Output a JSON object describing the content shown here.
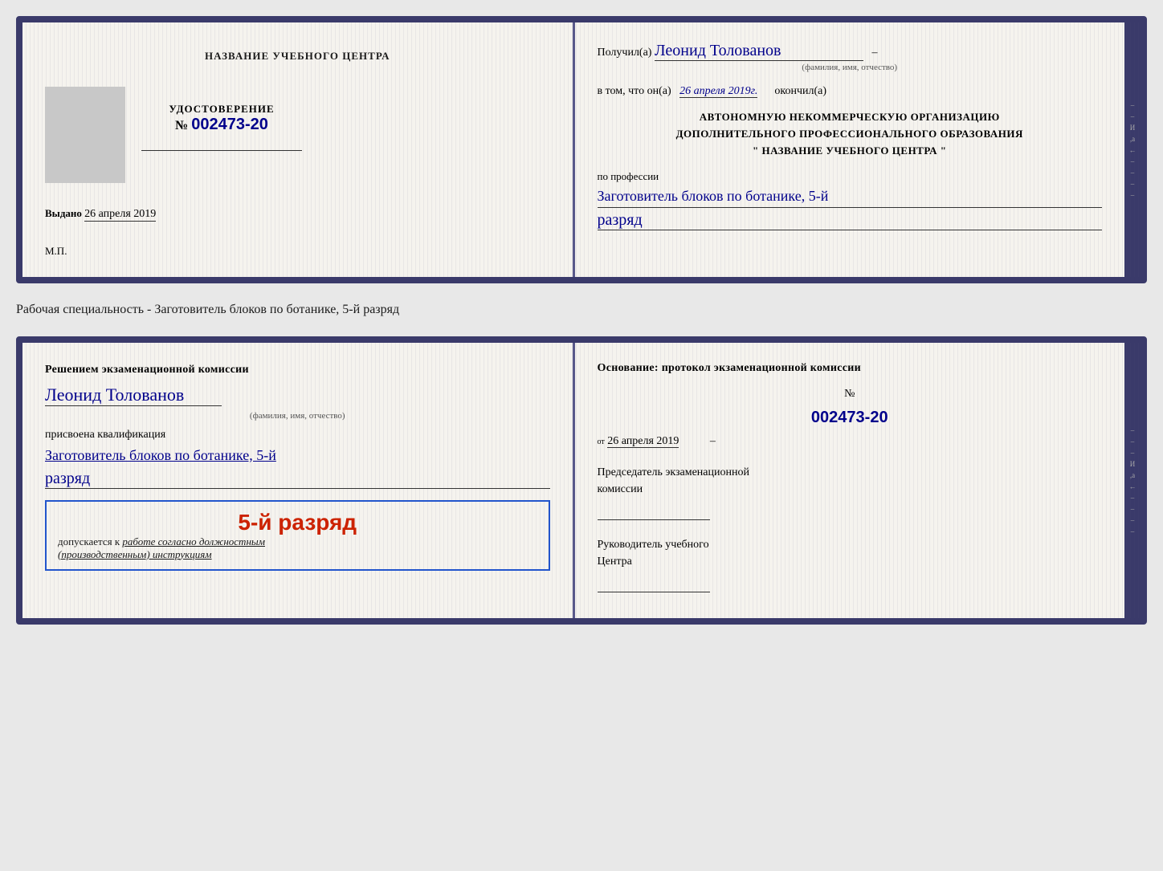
{
  "top_doc": {
    "left": {
      "title": "НАЗВАНИЕ УЧЕБНОГО ЦЕНТРА",
      "cert_label": "УДОСТОВЕРЕНИЕ",
      "cert_no_prefix": "№",
      "cert_no": "002473-20",
      "issued_label": "Выдано",
      "issued_date": "26 апреля 2019",
      "mp_label": "М.П."
    },
    "right": {
      "received_prefix": "Получил(а)",
      "received_name": "Леонид Толованов",
      "fio_label": "(фамилия, имя, отчество)",
      "vtom_text": "в том, что он(а)",
      "vtom_date": "26 апреля 2019г.",
      "okoncil": "окончил(а)",
      "org_line1": "АВТОНОМНУЮ НЕКОММЕРЧЕСКУЮ ОРГАНИЗАЦИЮ",
      "org_line2": "ДОПОЛНИТЕЛЬНОГО ПРОФЕССИОНАЛЬНОГО ОБРАЗОВАНИЯ",
      "org_line3": "\"   НАЗВАНИЕ УЧЕБНОГО ЦЕНТРА   \"",
      "profession_label": "по профессии",
      "profession_value": "Заготовитель блоков по ботанике, 5-й",
      "razryad_value": "разряд"
    }
  },
  "specialty_label": "Рабочая специальность - Заготовитель блоков по ботанике, 5-й разряд",
  "bottom_doc": {
    "left": {
      "decision_line": "Решением экзаменационной комиссии",
      "person_name": "Леонид Толованов",
      "fio_label": "(фамилия, имя, отчество)",
      "prisvoena_label": "присвоена квалификация",
      "qualification": "Заготовитель блоков по ботанике, 5-й",
      "razryad": "разряд",
      "badge_rank": "5-й разряд",
      "badge_admit_prefix": "допускается к",
      "badge_admit_italic": "работе согласно должностным",
      "badge_admit_italic2": "(производственным) инструкциям"
    },
    "right": {
      "osnov_label": "Основание: протокол экзаменационной комиссии",
      "protocol_prefix": "№",
      "protocol_no": "002473-20",
      "from_prefix": "от",
      "from_date": "26 апреля 2019",
      "predsed_line1": "Председатель экзаменационной",
      "predsed_line2": "комиссии",
      "rukov_line1": "Руководитель учебного",
      "rukov_line2": "Центра"
    }
  }
}
